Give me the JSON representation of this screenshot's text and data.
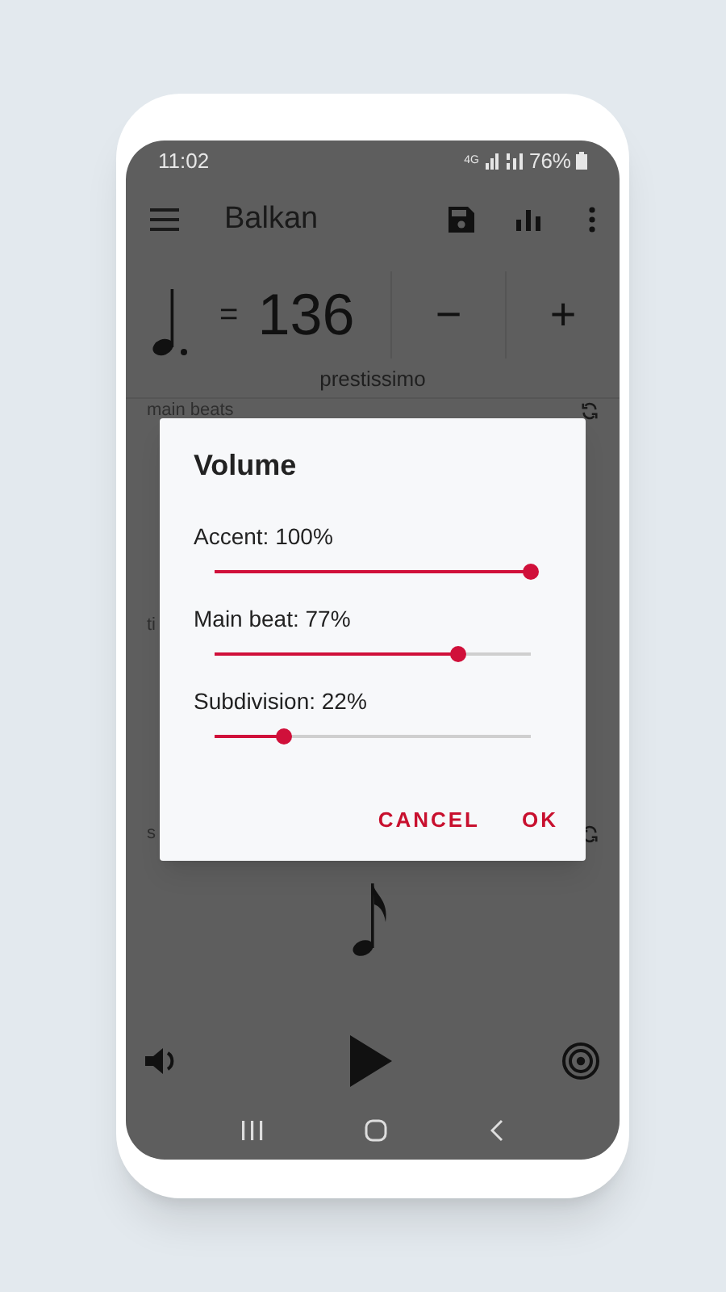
{
  "status_bar": {
    "time": "11:02",
    "network": "4G",
    "battery": "76%"
  },
  "toolbar": {
    "title": "Balkan"
  },
  "tempo": {
    "equals": "=",
    "bpm": "136",
    "decrease": "−",
    "increase": "+",
    "marking": "prestissimo"
  },
  "sections": [
    {
      "label": "main beats",
      "refresh": true
    },
    {
      "label": "ti",
      "refresh": false
    },
    {
      "label": "s",
      "refresh": true
    }
  ],
  "dialog": {
    "title": "Volume",
    "sliders": [
      {
        "label": "Accent: 100%",
        "level": 1
      },
      {
        "label": "Main beat: 77%",
        "level": 0.77
      },
      {
        "label": "Subdivision: 22%",
        "level": 0.22
      }
    ],
    "buttons": [
      "CANCEL",
      "OK"
    ]
  }
}
